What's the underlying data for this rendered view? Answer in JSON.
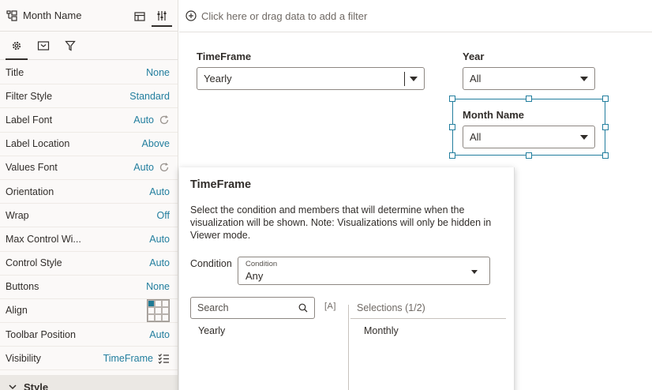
{
  "left_panel": {
    "header_title": "Month Name",
    "properties": [
      {
        "label": "Title",
        "value": "None"
      },
      {
        "label": "Filter Style",
        "value": "Standard"
      },
      {
        "label": "Label Font",
        "value": "Auto"
      },
      {
        "label": "Label Location",
        "value": "Above"
      },
      {
        "label": "Values Font",
        "value": "Auto"
      },
      {
        "label": "Orientation",
        "value": "Auto"
      },
      {
        "label": "Wrap",
        "value": "Off"
      },
      {
        "label": "Max Control Wi...",
        "value": "Auto"
      },
      {
        "label": "Control Style",
        "value": "Auto"
      },
      {
        "label": "Buttons",
        "value": "None"
      },
      {
        "label": "Align",
        "value": ""
      },
      {
        "label": "Toolbar Position",
        "value": "Auto"
      },
      {
        "label": "Visibility",
        "value": "TimeFrame"
      }
    ],
    "style_section": "Style"
  },
  "filter_bar": {
    "placeholder": "Click here or drag data to add a filter"
  },
  "canvas": {
    "timeframe": {
      "label": "TimeFrame",
      "value": "Yearly"
    },
    "year": {
      "label": "Year",
      "value": "All"
    },
    "month_name": {
      "label": "Month Name",
      "value": "All"
    }
  },
  "popup": {
    "title": "TimeFrame",
    "description": "Select the condition and members that will determine when the visualization will be shown. Note: Visualizations will only be hidden in Viewer mode.",
    "condition_label": "Condition",
    "condition_mini_label": "Condition",
    "condition_value": "Any",
    "search_placeholder": "Search",
    "case_toggle": "[A]",
    "selections_header": "Selections (1/2)",
    "available_items": [
      "Yearly"
    ],
    "selected_items": [
      "Monthly"
    ]
  },
  "colors": {
    "accent": "#227e9e",
    "selection_blue": "#1f7a94"
  }
}
